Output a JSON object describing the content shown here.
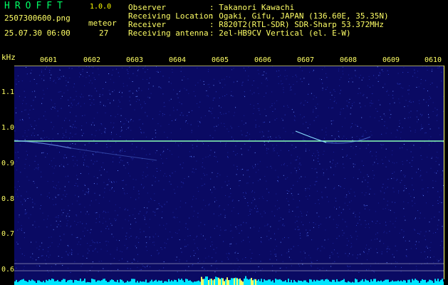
{
  "app": {
    "name": "HROFFT",
    "version": "1.0.0"
  },
  "file": {
    "name": "2507300600.png",
    "datetime": "25.07.30 06:00"
  },
  "meteor": {
    "label": "meteor",
    "count": "27"
  },
  "info": [
    {
      "key": "Observer",
      "value": ": Takanori Kawachi"
    },
    {
      "key": "Receiving Location",
      "value": ": Ogaki, Gifu, JAPAN (136.60E, 35.35N)"
    },
    {
      "key": "Receiver",
      "value": ": R820T2(RTL-SDR) SDR-Sharp 53.372MHz"
    },
    {
      "key": "Receiving antenna",
      "value": ": 2el-HB9CV Vertical (el. E-W)"
    }
  ],
  "axis": {
    "y_unit": "kHz",
    "x_ticks": [
      "0601",
      "0602",
      "0603",
      "0604",
      "0605",
      "0606",
      "0607",
      "0608",
      "0609",
      "0610"
    ],
    "y_ticks": [
      "1.1",
      "1.0",
      "0.9",
      "0.8",
      "0.7",
      "0.6"
    ]
  },
  "colors": {
    "text": "#ffff66",
    "title": "#00ff66",
    "background": "#0a0a63",
    "signal": "#66ffcc",
    "bars": "#00e5ff"
  }
}
